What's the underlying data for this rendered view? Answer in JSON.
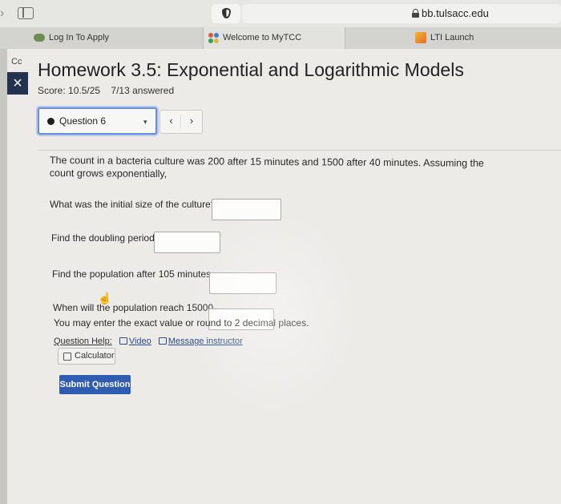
{
  "browser": {
    "back_glyph": "›",
    "url": "bb.tulsacc.edu",
    "tabs": [
      {
        "label": "Log In To Apply"
      },
      {
        "label": "Welcome to MyTCC"
      },
      {
        "label": "LTI Launch"
      }
    ]
  },
  "assignment": {
    "cut_label": "Cc",
    "close_glyph": "×",
    "title": "Homework 3.5: Exponential and Logarithmic Models",
    "score": "Score: 10.5/25",
    "answered": "7/13 answered"
  },
  "question_nav": {
    "selected": "Question 6",
    "caret": "▾",
    "prev": "‹",
    "next": "›"
  },
  "problem": {
    "statement": "The count in a bacteria culture was 200 after 15 minutes and 1500 after 40 minutes. Assuming the count grows exponentially,",
    "q1": "What was the initial size of the culture?",
    "q2": "Find the doubling period.",
    "q3": "Find the population after 105 minutes.",
    "q4": "When will the population reach 15000.",
    "note": "You may enter the exact value or round to 2 decimal places."
  },
  "help": {
    "label": "Question Help:",
    "video": "Video",
    "message": "Message instructor",
    "calculator": "Calculator"
  },
  "submit_label": "Submit Question",
  "colors": {
    "accent": "#2f5bb0",
    "close_bg": "#23324f",
    "focus_ring": "#6a8ed6"
  }
}
